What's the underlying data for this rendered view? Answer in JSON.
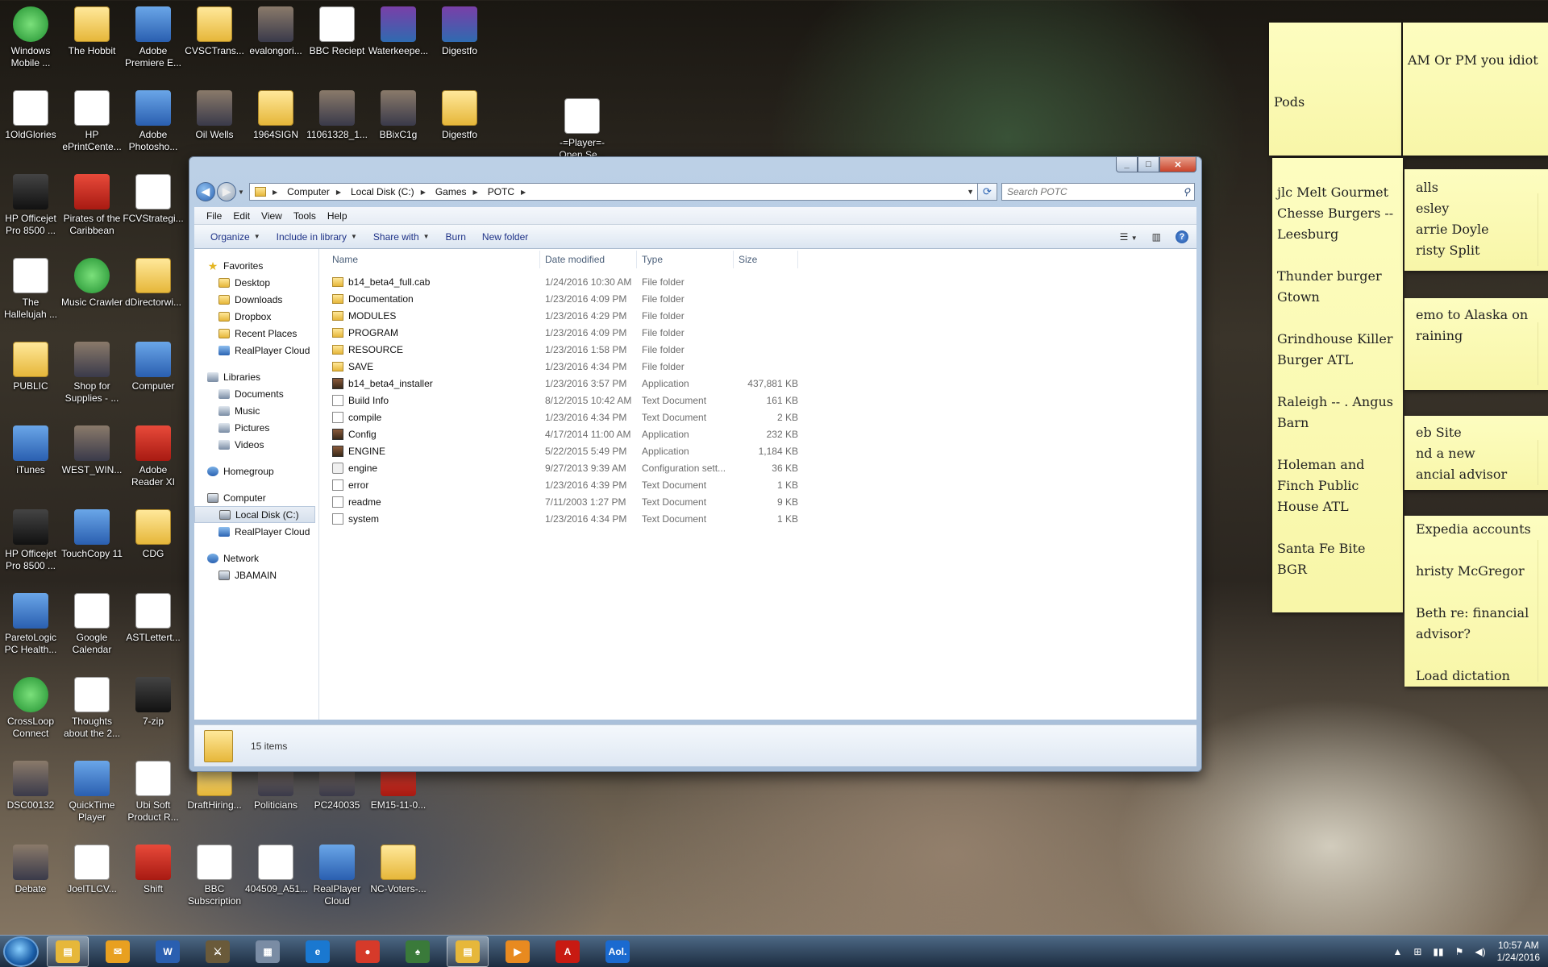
{
  "desktop_icons": [
    {
      "label": "Windows Mobile ...",
      "glyph": "green"
    },
    {
      "label": "The Hobbit",
      "glyph": "folder"
    },
    {
      "label": "Adobe Premiere E...",
      "glyph": "app"
    },
    {
      "label": "CVSCTrans...",
      "glyph": "folder"
    },
    {
      "label": "evalongori...",
      "glyph": "img"
    },
    {
      "label": "BBC Reciept",
      "glyph": "doc"
    },
    {
      "label": "Waterkeepe...",
      "glyph": "zip"
    },
    {
      "label": "Digestfo",
      "glyph": "zip"
    },
    {
      "label": "1OldGlories",
      "glyph": "doc"
    },
    {
      "label": "HP ePrintCente...",
      "glyph": "doc"
    },
    {
      "label": "Adobe Photosho...",
      "glyph": "app"
    },
    {
      "label": "Oil Wells",
      "glyph": "img"
    },
    {
      "label": "1964SIGN",
      "glyph": "folder"
    },
    {
      "label": "11061328_1...",
      "glyph": "img"
    },
    {
      "label": "BBixC1g",
      "glyph": "img"
    },
    {
      "label": "Digestfo",
      "glyph": "folder"
    },
    {
      "label": "-=Player=- Open Se...",
      "glyph": "doc"
    },
    {
      "label": "HP Officejet Pro 8500 ...",
      "glyph": "dark"
    },
    {
      "label": "Pirates of the Caribbean",
      "glyph": "red"
    },
    {
      "label": "FCVStrategi...",
      "glyph": "doc"
    },
    {
      "label": "The Hallelujah ...",
      "glyph": "doc"
    },
    {
      "label": "Music Crawler",
      "glyph": "green"
    },
    {
      "label": "dDirectorwi...",
      "glyph": "folder"
    },
    {
      "label": "PUBLIC",
      "glyph": "folder"
    },
    {
      "label": "Shop for Supplies - ...",
      "glyph": "img"
    },
    {
      "label": "Computer",
      "glyph": "app"
    },
    {
      "label": "iTunes",
      "glyph": "app"
    },
    {
      "label": "WEST_WIN...",
      "glyph": "img"
    },
    {
      "label": "Adobe Reader XI",
      "glyph": "red"
    },
    {
      "label": "HP Officejet Pro 8500 ...",
      "glyph": "dark"
    },
    {
      "label": "TouchCopy 11",
      "glyph": "app"
    },
    {
      "label": "CDG",
      "glyph": "folder"
    },
    {
      "label": "ParetoLogic PC Health...",
      "glyph": "app"
    },
    {
      "label": "Google Calendar",
      "glyph": "doc"
    },
    {
      "label": "ASTLettert...",
      "glyph": "doc"
    },
    {
      "label": "CrossLoop Connect",
      "glyph": "green"
    },
    {
      "label": "Thoughts about the 2...",
      "glyph": "doc"
    },
    {
      "label": "7-zip",
      "glyph": "dark"
    },
    {
      "label": "DSC00132",
      "glyph": "img"
    },
    {
      "label": "QuickTime Player",
      "glyph": "app"
    },
    {
      "label": "Ubi Soft Product R...",
      "glyph": "doc"
    },
    {
      "label": "DraftHiring...",
      "glyph": "folder"
    },
    {
      "label": "Politicians",
      "glyph": "img"
    },
    {
      "label": "PC240035",
      "glyph": "img"
    },
    {
      "label": "EM15-11-0...",
      "glyph": "red"
    },
    {
      "label": "Debate",
      "glyph": "img"
    },
    {
      "label": "JoelTLCV...",
      "glyph": "doc"
    },
    {
      "label": "Shift",
      "glyph": "red"
    },
    {
      "label": "BBC Subscription",
      "glyph": "doc"
    },
    {
      "label": "404509_A51...",
      "glyph": "doc"
    },
    {
      "label": "RealPlayer Cloud",
      "glyph": "app"
    },
    {
      "label": "NC-Voters-...",
      "glyph": "folder"
    }
  ],
  "notes": {
    "pods": "Pods",
    "ampm": "AM Or PM you idiot",
    "restaurants": [
      "jlc  Melt Gourmet Chesse Burgers -- Leesburg",
      "Thunder burger Gtown",
      "Grindhouse Killer Burger ATL",
      "Raleigh -- . Angus Barn",
      "Holeman and Finch Public House ATL",
      "Santa Fe Bite BGR"
    ],
    "calls": [
      "alls",
      "esley",
      "arrie Doyle",
      "risty Split"
    ],
    "memo": "emo to Alaska on raining",
    "website": [
      "eb Site",
      "nd a new",
      "ancial advisor"
    ],
    "accounts": [
      "Expedia accounts",
      "hristy McGregor",
      "Beth re: financial advisor?",
      "Load dictation"
    ]
  },
  "window": {
    "caption": {
      "min": "_",
      "max": "□",
      "close": "✕"
    },
    "breadcrumb": [
      "Computer",
      "Local Disk (C:)",
      "Games",
      "POTC"
    ],
    "search_placeholder": "Search POTC",
    "menu": [
      "File",
      "Edit",
      "View",
      "Tools",
      "Help"
    ],
    "commands": [
      {
        "label": "Organize",
        "dropdown": true
      },
      {
        "label": "Include in library",
        "dropdown": true
      },
      {
        "label": "Share with",
        "dropdown": true
      },
      {
        "label": "Burn",
        "dropdown": false
      },
      {
        "label": "New folder",
        "dropdown": false
      }
    ],
    "nav": {
      "favorites": {
        "label": "Favorites",
        "items": [
          "Desktop",
          "Downloads",
          "Dropbox",
          "Recent Places",
          "RealPlayer Cloud"
        ]
      },
      "libraries": {
        "label": "Libraries",
        "items": [
          "Documents",
          "Music",
          "Pictures",
          "Videos"
        ]
      },
      "homegroup": "Homegroup",
      "computer": {
        "label": "Computer",
        "items": [
          "Local Disk (C:)",
          "RealPlayer Cloud"
        ]
      },
      "network": {
        "label": "Network",
        "items": [
          "JBAMAIN"
        ]
      }
    },
    "columns": [
      "Name",
      "Date modified",
      "Type",
      "Size"
    ],
    "files": [
      {
        "name": "b14_beta4_full.cab",
        "date": "1/24/2016 10:30 AM",
        "type": "File folder",
        "size": "",
        "icon": "folder"
      },
      {
        "name": "Documentation",
        "date": "1/23/2016 4:09 PM",
        "type": "File folder",
        "size": "",
        "icon": "folder"
      },
      {
        "name": "MODULES",
        "date": "1/23/2016 4:29 PM",
        "type": "File folder",
        "size": "",
        "icon": "folder"
      },
      {
        "name": "PROGRAM",
        "date": "1/23/2016 4:09 PM",
        "type": "File folder",
        "size": "",
        "icon": "folder"
      },
      {
        "name": "RESOURCE",
        "date": "1/23/2016 1:58 PM",
        "type": "File folder",
        "size": "",
        "icon": "folder"
      },
      {
        "name": "SAVE",
        "date": "1/23/2016 4:34 PM",
        "type": "File folder",
        "size": "",
        "icon": "folder"
      },
      {
        "name": "b14_beta4_installer",
        "date": "1/23/2016 3:57 PM",
        "type": "Application",
        "size": "437,881 KB",
        "icon": "app"
      },
      {
        "name": "Build Info",
        "date": "8/12/2015 10:42 AM",
        "type": "Text Document",
        "size": "161 KB",
        "icon": "text"
      },
      {
        "name": "compile",
        "date": "1/23/2016 4:34 PM",
        "type": "Text Document",
        "size": "2 KB",
        "icon": "text"
      },
      {
        "name": "Config",
        "date": "4/17/2014 11:00 AM",
        "type": "Application",
        "size": "232 KB",
        "icon": "app"
      },
      {
        "name": "ENGINE",
        "date": "5/22/2015 5:49 PM",
        "type": "Application",
        "size": "1,184 KB",
        "icon": "app"
      },
      {
        "name": "engine",
        "date": "9/27/2013 9:39 AM",
        "type": "Configuration sett...",
        "size": "36 KB",
        "icon": "cfg"
      },
      {
        "name": "error",
        "date": "1/23/2016 4:39 PM",
        "type": "Text Document",
        "size": "1 KB",
        "icon": "text"
      },
      {
        "name": "readme",
        "date": "7/11/2003 1:27 PM",
        "type": "Text Document",
        "size": "9 KB",
        "icon": "text"
      },
      {
        "name": "system",
        "date": "1/23/2016 4:34 PM",
        "type": "Text Document",
        "size": "1 KB",
        "icon": "text"
      }
    ],
    "status": "15 items"
  },
  "taskbar": {
    "items": [
      {
        "name": "explorer",
        "glyph": "▤",
        "color": "#e6b73a",
        "active": true
      },
      {
        "name": "outlook",
        "glyph": "✉",
        "color": "#e8a020",
        "active": false
      },
      {
        "name": "word",
        "glyph": "W",
        "color": "#2a5fb0",
        "active": false
      },
      {
        "name": "pirates",
        "glyph": "⚔",
        "color": "#6a5a3a",
        "active": false
      },
      {
        "name": "calculator",
        "glyph": "▦",
        "color": "#7a8ca4",
        "active": false
      },
      {
        "name": "ie",
        "glyph": "e",
        "color": "#1a78d0",
        "active": false
      },
      {
        "name": "chrome",
        "glyph": "●",
        "color": "#d63a2a",
        "active": false
      },
      {
        "name": "solitaire",
        "glyph": "♠",
        "color": "#3a7a3a",
        "active": false
      },
      {
        "name": "folder",
        "glyph": "▤",
        "color": "#e6b73a",
        "active": true
      },
      {
        "name": "media",
        "glyph": "▶",
        "color": "#e88a20",
        "active": false
      },
      {
        "name": "acrobat",
        "glyph": "A",
        "color": "#c81a12",
        "active": false
      },
      {
        "name": "aol",
        "glyph": "Aol.",
        "color": "#1a6ad0",
        "active": false
      }
    ],
    "time": "10:57 AM",
    "date": "1/24/2016"
  }
}
